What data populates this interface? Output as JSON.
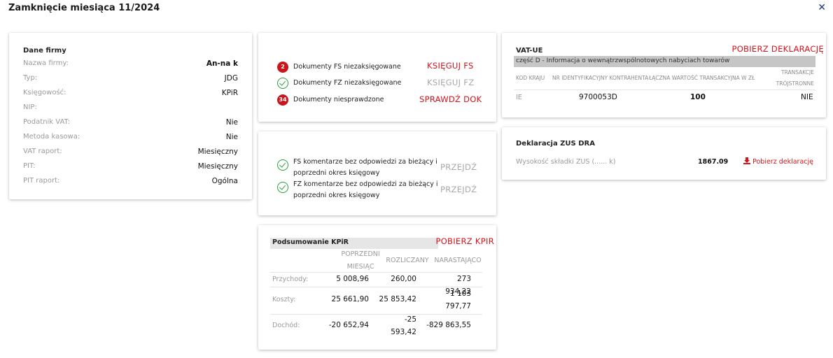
{
  "modal": {
    "title": "Zamknięcie miesiąca 11/2024",
    "close_icon": "✕"
  },
  "firma": {
    "heading": "Dane firmy",
    "rows": [
      {
        "label": "Nazwa firmy:",
        "value": "An-na k"
      },
      {
        "label": "Typ:",
        "value": "JDG"
      },
      {
        "label": "Księgowość:",
        "value": "KPiR"
      },
      {
        "label": "NIP:",
        "value": ""
      },
      {
        "label": "Podatnik VAT:",
        "value": "Nie"
      },
      {
        "label": "Metoda kasowa:",
        "value": "Nie"
      },
      {
        "label": "VAT raport:",
        "value": "Miesięczny"
      },
      {
        "label": "PIT:",
        "value": "Miesięczny"
      },
      {
        "label": "PIT raport:",
        "value": "Ogólna"
      }
    ]
  },
  "documents": {
    "items": [
      {
        "status": "badge",
        "badge": "2",
        "text": "Dokumenty FS niezaksięgowane",
        "action": "KSIĘGUJ FS",
        "action_state": "active"
      },
      {
        "status": "check",
        "badge": "",
        "text": "Dokumenty FZ niezaksięgowane",
        "action": "KSIĘGUJ FZ",
        "action_state": "disabled"
      },
      {
        "status": "badge",
        "badge": "34",
        "text": "Dokumenty niesprawdzone",
        "action": "SPRAWDŹ DOK",
        "action_state": "active"
      }
    ]
  },
  "comments": {
    "items": [
      {
        "text": "FS komentarze bez odpowiedzi za bieżący i poprzedni okres księgowy",
        "action": "PRZEJDŹ"
      },
      {
        "text": "FZ komentarze bez odpowiedzi za bieżący i poprzedni okres księgowy",
        "action": "PRZEJDŹ"
      }
    ]
  },
  "kpir": {
    "title": "Podsumowanie KPiR",
    "download": "POBIERZ KPIR",
    "columns": [
      "POPRZEDNI MIESIĄC",
      "ROZLICZANY",
      "NARASTAJĄCO"
    ],
    "rows": [
      {
        "label": "Przychody:",
        "values": [
          "5 008,96",
          "260,00",
          "273 934,22"
        ]
      },
      {
        "label": "Koszty:",
        "values": [
          "25 661,90",
          "25 853,42",
          "1 103 797,77"
        ]
      },
      {
        "label": "Dochód:",
        "values": [
          "-20 652,94",
          "-25 593,42",
          "-829 863,55"
        ]
      }
    ]
  },
  "vat_ue": {
    "title": "VAT-UE",
    "download": "POBIERZ DEKLARACJĘ",
    "subtitle": "część D - Informacja o wewnątrzwspólnotowych nabyciach towarów",
    "columns": [
      "KOD KRAJU",
      "NR IDENTYFIKACYJNY KONTRAHENTA",
      "ŁĄCZNA WARTOŚĆ TRANSAKCYJNA W ZŁ",
      "TRANSAKCJE TRÓJSTRONNE"
    ],
    "row": [
      "IE",
      "9700053D",
      "100",
      "NIE"
    ]
  },
  "zus": {
    "title": "Deklaracja ZUS DRA",
    "label": "Wysokość składki ZUS (...... k)",
    "value": "1867.09",
    "download": "Pobierz deklarację"
  },
  "colors": {
    "accent_red": "#d4131b",
    "check_green": "#2a9d3a",
    "disabled_grey": "#a8a8a8"
  }
}
